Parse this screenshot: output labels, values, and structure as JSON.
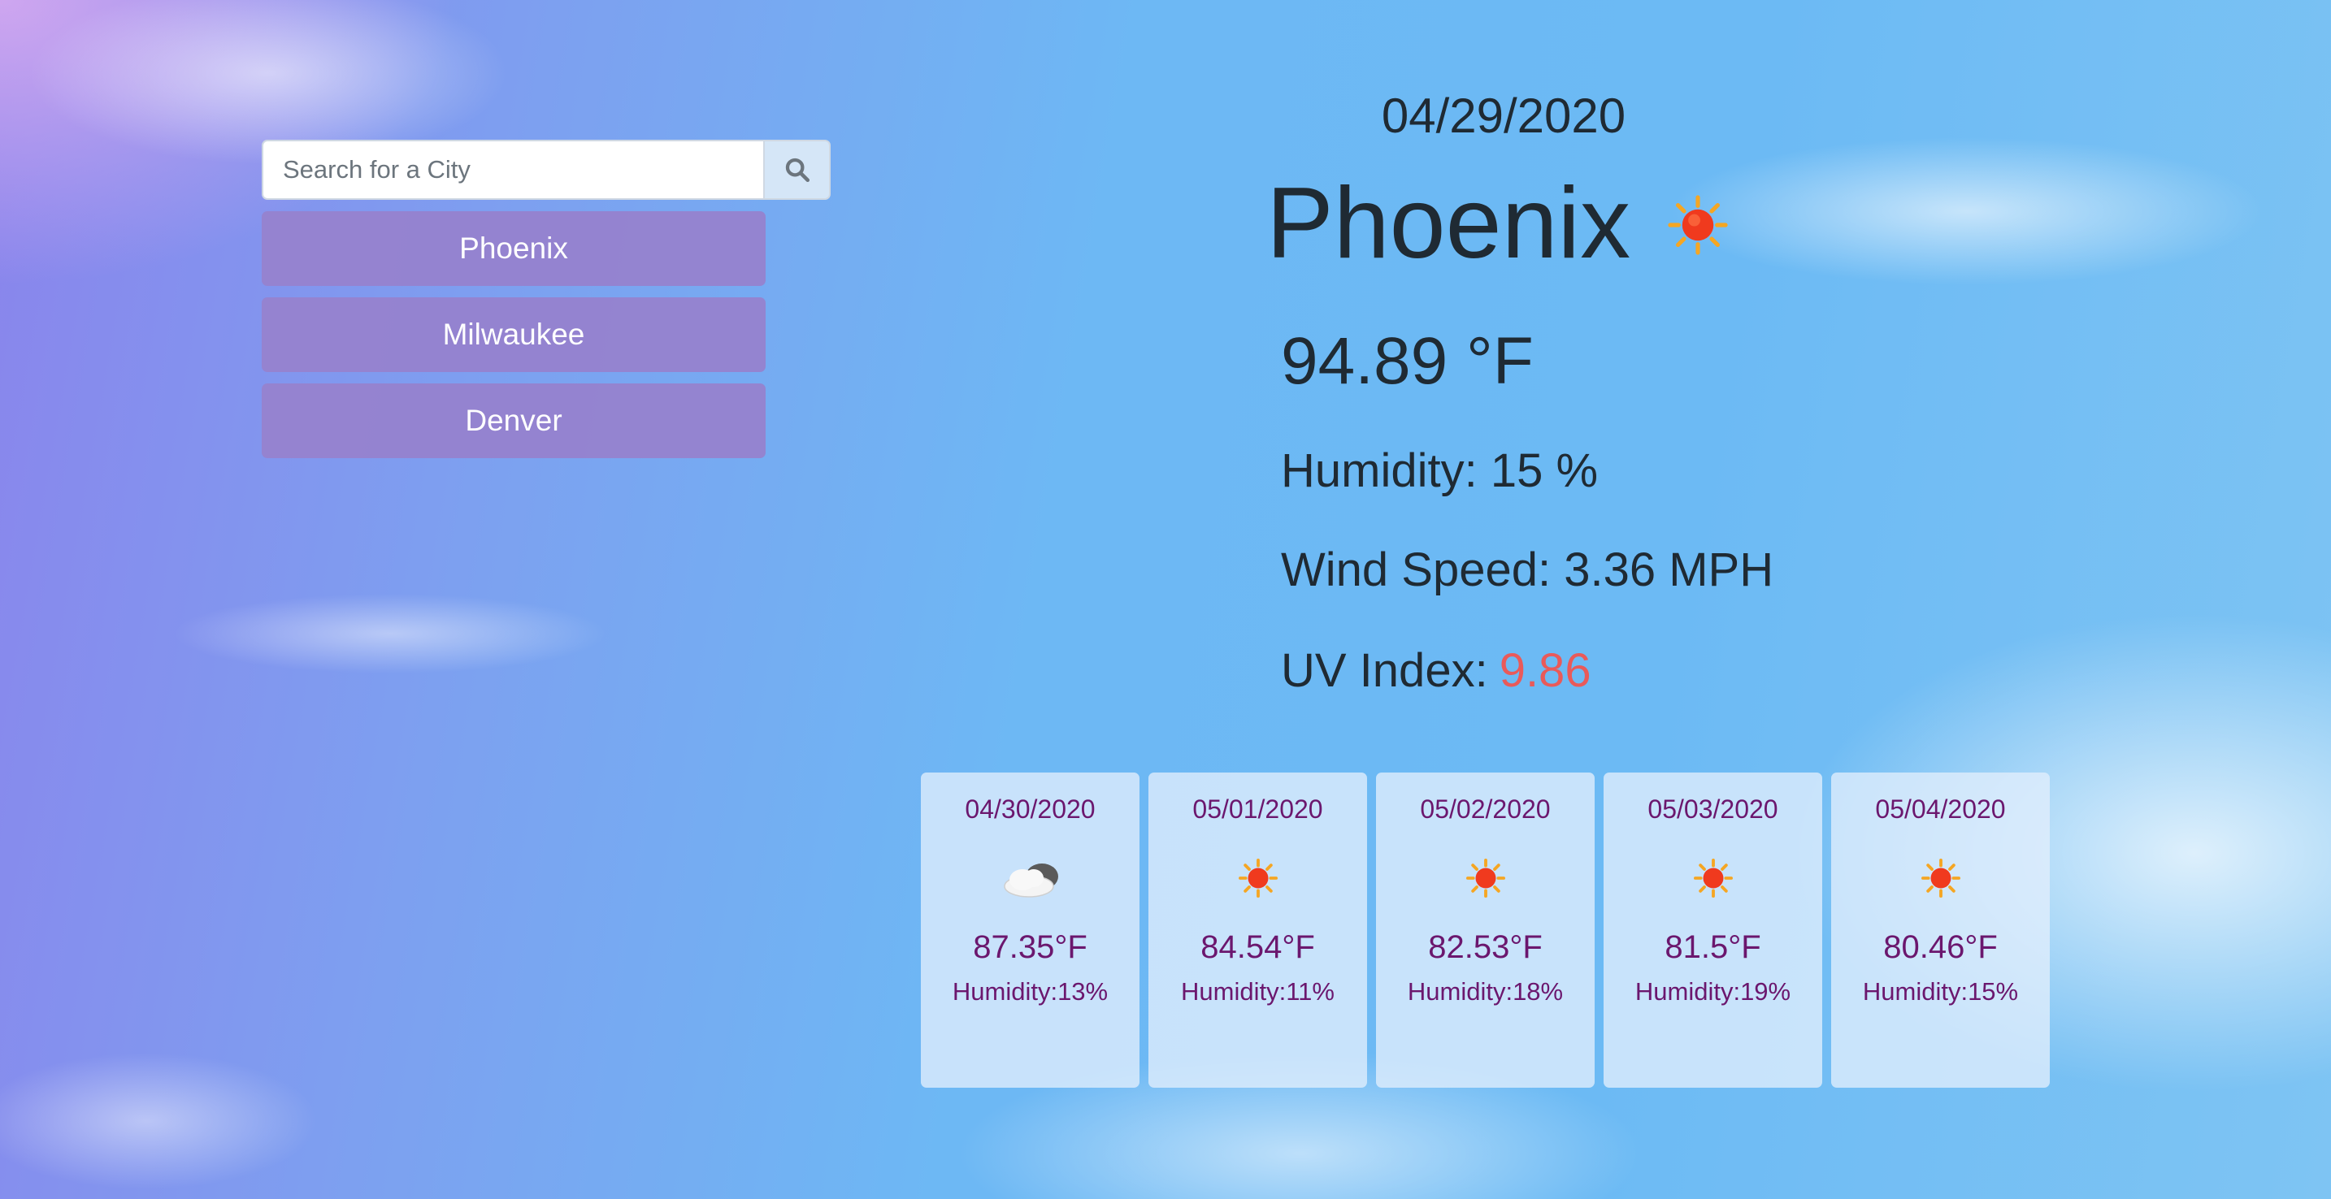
{
  "search": {
    "placeholder": "Search for a City",
    "button_icon": "search-icon"
  },
  "history": {
    "cities": [
      "Phoenix",
      "Milwaukee",
      "Denver"
    ]
  },
  "current": {
    "date": "04/29/2020",
    "city": "Phoenix",
    "icon": "sun-icon",
    "temperature": "94.89 °F",
    "humidity": "Humidity: 15 %",
    "wind": "Wind Speed: 3.36 MPH",
    "uv_label": "UV Index:",
    "uv_value": "9.86",
    "uv_color": "#e95a5a"
  },
  "forecast": [
    {
      "date": "04/30/2020",
      "icon": "cloud-icon",
      "temp": "87.35°F",
      "humidity": "Humidity:13%"
    },
    {
      "date": "05/01/2020",
      "icon": "sun-icon",
      "temp": "84.54°F",
      "humidity": "Humidity:11%"
    },
    {
      "date": "05/02/2020",
      "icon": "sun-icon",
      "temp": "82.53°F",
      "humidity": "Humidity:18%"
    },
    {
      "date": "05/03/2020",
      "icon": "sun-icon",
      "temp": "81.5°F",
      "humidity": "Humidity:19%"
    },
    {
      "date": "05/04/2020",
      "icon": "sun-icon",
      "temp": "80.46°F",
      "humidity": "Humidity:15%"
    }
  ],
  "colors": {
    "city_button": "#9682cd",
    "forecast_text": "#6b176e",
    "main_text": "#1f2a33"
  }
}
